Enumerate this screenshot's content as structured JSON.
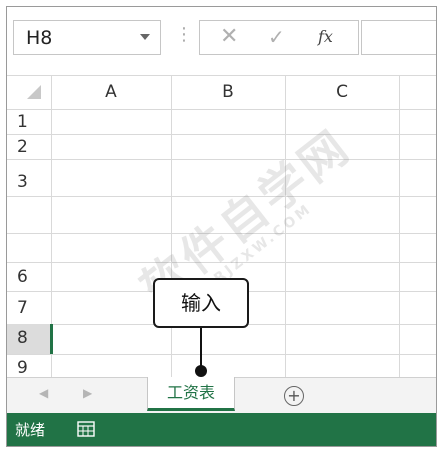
{
  "formula_bar": {
    "name_box_value": "H8",
    "grip": "⋮",
    "cancel_icon": "✕",
    "enter_icon": "✓",
    "fx_label": "fx",
    "formula_value": ""
  },
  "grid": {
    "columns": [
      "A",
      "B",
      "C"
    ],
    "rows": [
      "1",
      "2",
      "3",
      "",
      "",
      "6",
      "7",
      "8",
      "9"
    ],
    "selected_row": "8",
    "selected_cell": "H8"
  },
  "sheet_tabs": {
    "nav_prev": "◀",
    "nav_next": "▶",
    "active_tab": "工资表",
    "add_sheet": "+"
  },
  "status_bar": {
    "ready_text": "就绪",
    "macro_icon": "macro-record-icon",
    "accent": "#217346"
  },
  "annotation": {
    "callout_text": "输入"
  },
  "watermark": {
    "text": "软件自学网",
    "url": "WWW.RJZXW.COM"
  }
}
